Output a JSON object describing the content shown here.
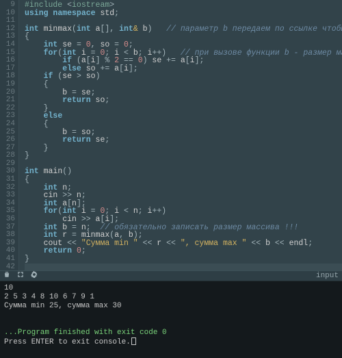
{
  "divider": {
    "label": "input"
  },
  "code": [
    [
      [
        "inc",
        "#include"
      ],
      [
        "pl",
        " "
      ],
      [
        "op",
        "<"
      ],
      [
        "inc",
        "iostream"
      ],
      [
        "op",
        ">"
      ]
    ],
    [
      [
        "kw",
        "using"
      ],
      [
        "pl",
        " "
      ],
      [
        "kw",
        "namespace"
      ],
      [
        "pl",
        " std"
      ],
      [
        "op",
        ";"
      ]
    ],
    [],
    [
      [
        "ty",
        "int"
      ],
      [
        "pl",
        " "
      ],
      [
        "fn",
        "minmax"
      ],
      [
        "op",
        "("
      ],
      [
        "ty",
        "int"
      ],
      [
        "pl",
        " a"
      ],
      [
        "op",
        "[]"
      ],
      [
        "op",
        ","
      ],
      [
        "pl",
        " "
      ],
      [
        "ty",
        "int"
      ],
      [
        "amp",
        "&"
      ],
      [
        "pl",
        " b"
      ],
      [
        "op",
        ")"
      ],
      [
        "pl",
        "   "
      ],
      [
        "com",
        "// параметр b передаем по ссылке чтобы его менять"
      ]
    ],
    [
      [
        "op",
        "{"
      ]
    ],
    [
      [
        "pl",
        "    "
      ],
      [
        "ty",
        "int"
      ],
      [
        "pl",
        " se "
      ],
      [
        "op",
        "="
      ],
      [
        "pl",
        " "
      ],
      [
        "num",
        "0"
      ],
      [
        "op",
        ","
      ],
      [
        "pl",
        " so "
      ],
      [
        "op",
        "="
      ],
      [
        "pl",
        " "
      ],
      [
        "num",
        "0"
      ],
      [
        "op",
        ";"
      ]
    ],
    [
      [
        "pl",
        "    "
      ],
      [
        "kw",
        "for"
      ],
      [
        "op",
        "("
      ],
      [
        "ty",
        "int"
      ],
      [
        "pl",
        " i "
      ],
      [
        "op",
        "="
      ],
      [
        "pl",
        " "
      ],
      [
        "num",
        "0"
      ],
      [
        "op",
        ";"
      ],
      [
        "pl",
        " i "
      ],
      [
        "op",
        "<"
      ],
      [
        "pl",
        " b"
      ],
      [
        "op",
        ";"
      ],
      [
        "pl",
        " i"
      ],
      [
        "op",
        "++"
      ],
      [
        "op",
        ")"
      ],
      [
        "pl",
        "   "
      ],
      [
        "com",
        "// при вызове функции b - размер массива"
      ]
    ],
    [
      [
        "pl",
        "        "
      ],
      [
        "kw",
        "if"
      ],
      [
        "pl",
        " "
      ],
      [
        "op",
        "("
      ],
      [
        "pl",
        "a"
      ],
      [
        "op",
        "["
      ],
      [
        "pl",
        "i"
      ],
      [
        "op",
        "]"
      ],
      [
        "pl",
        " "
      ],
      [
        "op",
        "%"
      ],
      [
        "pl",
        " "
      ],
      [
        "num",
        "2"
      ],
      [
        "pl",
        " "
      ],
      [
        "op",
        "=="
      ],
      [
        "pl",
        " "
      ],
      [
        "num",
        "0"
      ],
      [
        "op",
        ")"
      ],
      [
        "pl",
        " se "
      ],
      [
        "op",
        "+="
      ],
      [
        "pl",
        " a"
      ],
      [
        "op",
        "["
      ],
      [
        "pl",
        "i"
      ],
      [
        "op",
        "];"
      ]
    ],
    [
      [
        "pl",
        "        "
      ],
      [
        "kw",
        "else"
      ],
      [
        "pl",
        " so "
      ],
      [
        "op",
        "+="
      ],
      [
        "pl",
        " a"
      ],
      [
        "op",
        "["
      ],
      [
        "pl",
        "i"
      ],
      [
        "op",
        "];"
      ]
    ],
    [
      [
        "pl",
        "    "
      ],
      [
        "kw",
        "if"
      ],
      [
        "pl",
        " "
      ],
      [
        "op",
        "("
      ],
      [
        "pl",
        "se "
      ],
      [
        "op",
        ">"
      ],
      [
        "pl",
        " so"
      ],
      [
        "op",
        ")"
      ]
    ],
    [
      [
        "pl",
        "    "
      ],
      [
        "op",
        "{"
      ]
    ],
    [
      [
        "pl",
        "        b "
      ],
      [
        "op",
        "="
      ],
      [
        "pl",
        " se"
      ],
      [
        "op",
        ";"
      ]
    ],
    [
      [
        "pl",
        "        "
      ],
      [
        "kw",
        "return"
      ],
      [
        "pl",
        " so"
      ],
      [
        "op",
        ";"
      ]
    ],
    [
      [
        "pl",
        "    "
      ],
      [
        "op",
        "}"
      ]
    ],
    [
      [
        "pl",
        "    "
      ],
      [
        "kw",
        "else"
      ]
    ],
    [
      [
        "pl",
        "    "
      ],
      [
        "op",
        "{"
      ]
    ],
    [
      [
        "pl",
        "        b "
      ],
      [
        "op",
        "="
      ],
      [
        "pl",
        " so"
      ],
      [
        "op",
        ";"
      ]
    ],
    [
      [
        "pl",
        "        "
      ],
      [
        "kw",
        "return"
      ],
      [
        "pl",
        " se"
      ],
      [
        "op",
        ";"
      ]
    ],
    [
      [
        "pl",
        "    "
      ],
      [
        "op",
        "}"
      ]
    ],
    [
      [
        "op",
        "}"
      ]
    ],
    [],
    [
      [
        "ty",
        "int"
      ],
      [
        "pl",
        " "
      ],
      [
        "fn",
        "main"
      ],
      [
        "op",
        "()"
      ]
    ],
    [
      [
        "op",
        "{"
      ]
    ],
    [
      [
        "pl",
        "    "
      ],
      [
        "ty",
        "int"
      ],
      [
        "pl",
        " n"
      ],
      [
        "op",
        ";"
      ]
    ],
    [
      [
        "pl",
        "    cin "
      ],
      [
        "op",
        ">>"
      ],
      [
        "pl",
        " n"
      ],
      [
        "op",
        ";"
      ]
    ],
    [
      [
        "pl",
        "    "
      ],
      [
        "ty",
        "int"
      ],
      [
        "pl",
        " a"
      ],
      [
        "op",
        "["
      ],
      [
        "pl",
        "n"
      ],
      [
        "op",
        "];"
      ]
    ],
    [
      [
        "pl",
        "    "
      ],
      [
        "kw",
        "for"
      ],
      [
        "op",
        "("
      ],
      [
        "ty",
        "int"
      ],
      [
        "pl",
        " i "
      ],
      [
        "op",
        "="
      ],
      [
        "pl",
        " "
      ],
      [
        "num",
        "0"
      ],
      [
        "op",
        ";"
      ],
      [
        "pl",
        " i "
      ],
      [
        "op",
        "<"
      ],
      [
        "pl",
        " n"
      ],
      [
        "op",
        ";"
      ],
      [
        "pl",
        " i"
      ],
      [
        "op",
        "++"
      ],
      [
        "op",
        ")"
      ]
    ],
    [
      [
        "pl",
        "        cin "
      ],
      [
        "op",
        ">>"
      ],
      [
        "pl",
        " a"
      ],
      [
        "op",
        "["
      ],
      [
        "pl",
        "i"
      ],
      [
        "op",
        "];"
      ]
    ],
    [
      [
        "pl",
        "    "
      ],
      [
        "ty",
        "int"
      ],
      [
        "pl",
        " b "
      ],
      [
        "op",
        "="
      ],
      [
        "pl",
        " n"
      ],
      [
        "op",
        ";"
      ],
      [
        "pl",
        "  "
      ],
      [
        "com",
        "// обязательно записать размер массива !!!"
      ]
    ],
    [
      [
        "pl",
        "    "
      ],
      [
        "ty",
        "int"
      ],
      [
        "pl",
        " r "
      ],
      [
        "op",
        "="
      ],
      [
        "pl",
        " "
      ],
      [
        "fn",
        "minmax"
      ],
      [
        "op",
        "("
      ],
      [
        "pl",
        "a"
      ],
      [
        "op",
        ","
      ],
      [
        "pl",
        " b"
      ],
      [
        "op",
        ");"
      ]
    ],
    [
      [
        "pl",
        "    cout "
      ],
      [
        "op",
        "<<"
      ],
      [
        "pl",
        " "
      ],
      [
        "str",
        "\"Сумма min \""
      ],
      [
        "pl",
        " "
      ],
      [
        "op",
        "<<"
      ],
      [
        "pl",
        " r "
      ],
      [
        "op",
        "<<"
      ],
      [
        "pl",
        " "
      ],
      [
        "str",
        "\", сумма max \""
      ],
      [
        "pl",
        " "
      ],
      [
        "op",
        "<<"
      ],
      [
        "pl",
        " b "
      ],
      [
        "op",
        "<<"
      ],
      [
        "pl",
        " endl"
      ],
      [
        "op",
        ";"
      ]
    ],
    [
      [
        "pl",
        "    "
      ],
      [
        "kw",
        "return"
      ],
      [
        "pl",
        " "
      ],
      [
        "num",
        "0"
      ],
      [
        "op",
        ";"
      ]
    ],
    [
      [
        "op",
        "}"
      ]
    ],
    []
  ],
  "line_start": 9,
  "current_line": 42,
  "console": {
    "lines": [
      "10",
      "2 5 3 4 8 10 6 7 9 1",
      "Сумма min 25, сумма max 30",
      "",
      "",
      "...Program finished with exit code 0",
      "Press ENTER to exit console."
    ],
    "ok_index": 5
  }
}
